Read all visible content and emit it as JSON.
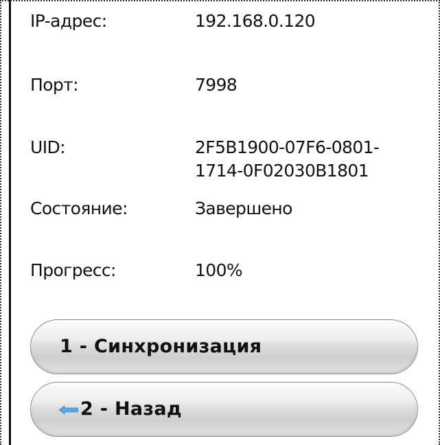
{
  "info": {
    "ip": {
      "label": "IP-адрес:",
      "value": "192.168.0.120"
    },
    "port": {
      "label": "Порт:",
      "value": "7998"
    },
    "uid": {
      "label": "UID:",
      "value": "2F5B1900-07F6-0801-\n1714-0F02030B1801"
    },
    "state": {
      "label": "Состояние:",
      "value": "Завершено"
    },
    "progress": {
      "label": "Прогресс:",
      "value": "100%"
    }
  },
  "buttons": {
    "sync_label": "1 - Синхронизация",
    "back_label": "2 - Назад"
  },
  "icons": {
    "back": "arrow-left-icon"
  },
  "colors": {
    "text": "#111111",
    "back_arrow": "#5aa9e6",
    "frame": "#333333"
  }
}
